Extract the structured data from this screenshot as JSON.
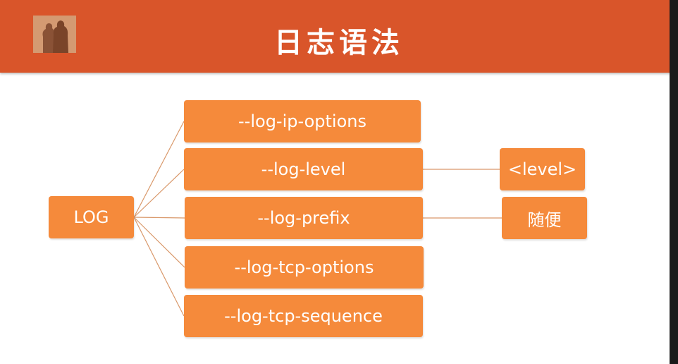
{
  "header": {
    "title": "日志语法",
    "background_color": "#d9552a"
  },
  "diagram": {
    "root": {
      "label": "LOG"
    },
    "options": [
      {
        "label": "--log-ip-options"
      },
      {
        "label": "--log-level"
      },
      {
        "label": "--log-prefix"
      },
      {
        "label": "--log-tcp-options"
      },
      {
        "label": "--log-tcp-sequence"
      }
    ],
    "values": [
      {
        "label": "<level>",
        "parent": "--log-level"
      },
      {
        "label": "随便",
        "parent": "--log-prefix"
      }
    ],
    "box_color": "#f58a3b",
    "line_color": "#d9986a"
  }
}
